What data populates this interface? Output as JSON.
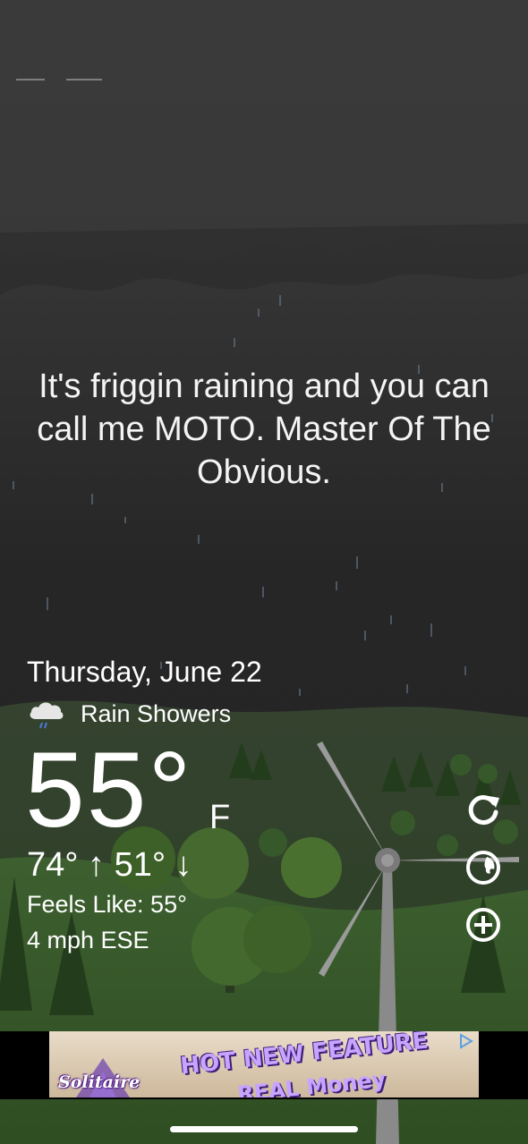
{
  "quote": "It's friggin raining and you can call me MOTO. Master Of The Obvious.",
  "weather": {
    "date": "Thursday, June 22",
    "condition_icon": "rain-cloud-icon",
    "condition": "Rain Showers",
    "temperature": "55°",
    "unit": "F",
    "high_low": "74° ↑ 51° ↓",
    "feels_like": "Feels Like: 55°",
    "wind": "4 mph ESE"
  },
  "side_buttons": {
    "refresh_icon": "refresh-icon",
    "radar_icon": "radar-globe-icon",
    "add_icon": "add-location-icon"
  },
  "ad": {
    "logo": "Solitaire",
    "headline": "HOT NEW FEATURE",
    "subline": "REAL Money",
    "ad_choices_icon": "ad-choices-icon"
  },
  "colors": {
    "sky_top": "#3a3a3a",
    "sky_bottom": "#232323",
    "hills": "#3b5b2d",
    "accent_text": "#ffffff"
  }
}
